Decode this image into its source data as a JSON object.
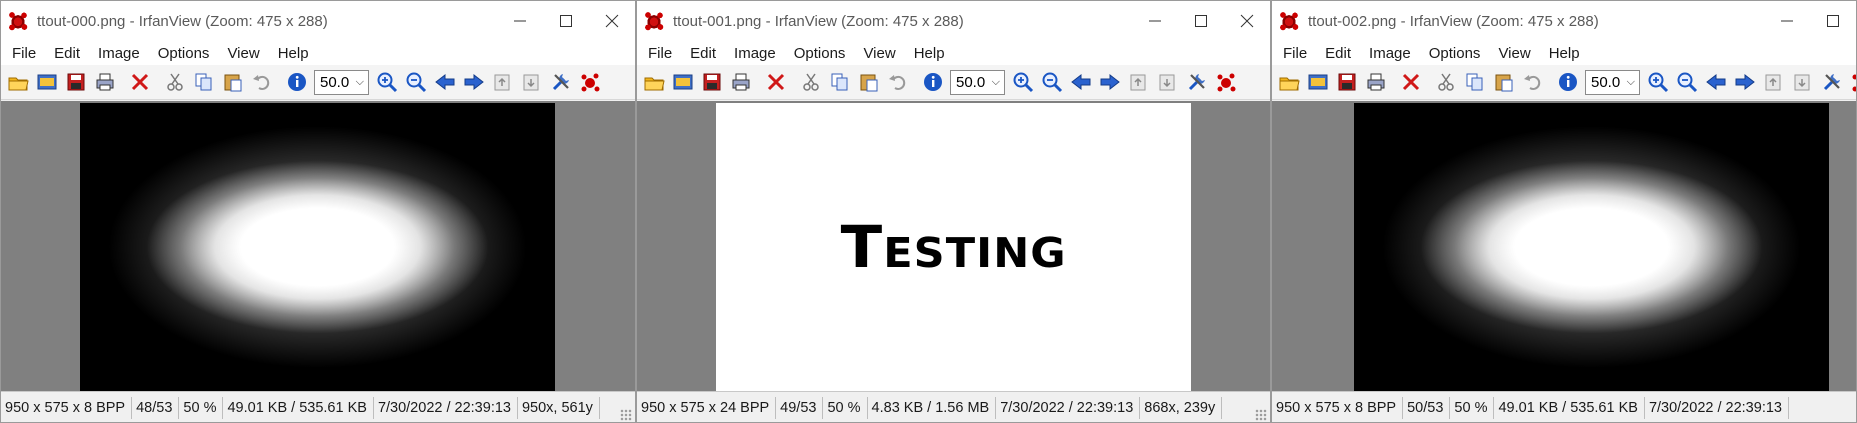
{
  "windows": [
    {
      "title": "ttout-000.png - IrfanView (Zoom: 475 x 288)",
      "menu": [
        "File",
        "Edit",
        "Image",
        "Options",
        "View",
        "Help"
      ],
      "zoom_value": "50.0",
      "image_kind": "noise",
      "status": [
        "950 x 575 x 8 BPP",
        "48/53",
        "50 %",
        "49.01 KB / 535.61 KB",
        "7/30/2022 / 22:39:13",
        "950x, 561y"
      ]
    },
    {
      "title": "ttout-001.png - IrfanView (Zoom: 475 x 288)",
      "menu": [
        "File",
        "Edit",
        "Image",
        "Options",
        "View",
        "Help"
      ],
      "zoom_value": "50.0",
      "image_kind": "text",
      "image_text": "Testing",
      "status": [
        "950 x 575 x 24 BPP",
        "49/53",
        "50 %",
        "4.83 KB / 1.56 MB",
        "7/30/2022 / 22:39:13",
        "868x, 239y"
      ]
    },
    {
      "title": "ttout-002.png - IrfanView (Zoom: 475 x 288)",
      "menu": [
        "File",
        "Edit",
        "Image",
        "Options",
        "View",
        "Help"
      ],
      "zoom_value": "50.0",
      "image_kind": "noise",
      "status": [
        "950 x 575 x 8 BPP",
        "50/53",
        "50 %",
        "49.01 KB / 535.61 KB",
        "7/30/2022 / 22:39:13"
      ]
    }
  ],
  "toolbar_icons": [
    "open-folder-icon",
    "thumbnails-icon",
    "save-icon",
    "print-icon",
    "delete-icon",
    "cut-icon",
    "copy-icon",
    "paste-icon",
    "undo-icon",
    "info-icon",
    "zoom-in-icon",
    "zoom-out-icon",
    "previous-icon",
    "next-icon",
    "first-icon",
    "last-icon",
    "settings-icon",
    "irfanview-icon"
  ],
  "colors": {
    "canvas_bg": "#808080",
    "accent_blue": "#1a56c4",
    "delete_red": "#d01818",
    "logo_red": "#c00000"
  }
}
